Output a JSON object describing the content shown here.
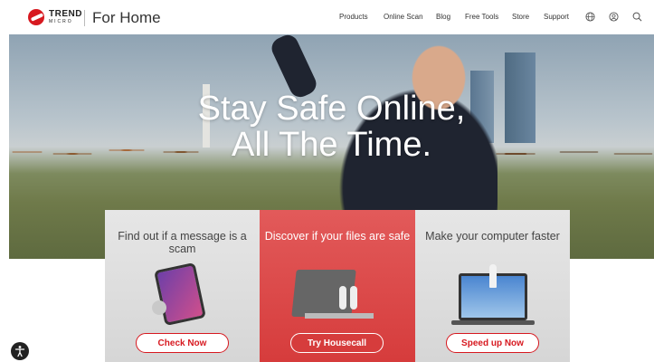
{
  "brand": {
    "name_top": "TREND",
    "name_bottom": "MICRO",
    "section": "For Home",
    "accent": "#d71920"
  },
  "nav": {
    "items": [
      {
        "label": "Products"
      },
      {
        "label": "Online Scan"
      },
      {
        "label": "Blog"
      },
      {
        "label": "Free Tools"
      },
      {
        "label": "Store"
      },
      {
        "label": "Support"
      }
    ],
    "icons": [
      "globe-icon",
      "account-icon",
      "search-icon"
    ]
  },
  "hero": {
    "line1": "Stay Safe Online,",
    "line2": "All The Time."
  },
  "cards": [
    {
      "title": "Find out if a message is a scam",
      "button": "Check Now"
    },
    {
      "title": "Discover if your files are safe",
      "button": "Try Housecall"
    },
    {
      "title": "Make your computer faster",
      "button": "Speed up Now"
    }
  ],
  "accessibility": {
    "icon": "accessibility-icon"
  }
}
